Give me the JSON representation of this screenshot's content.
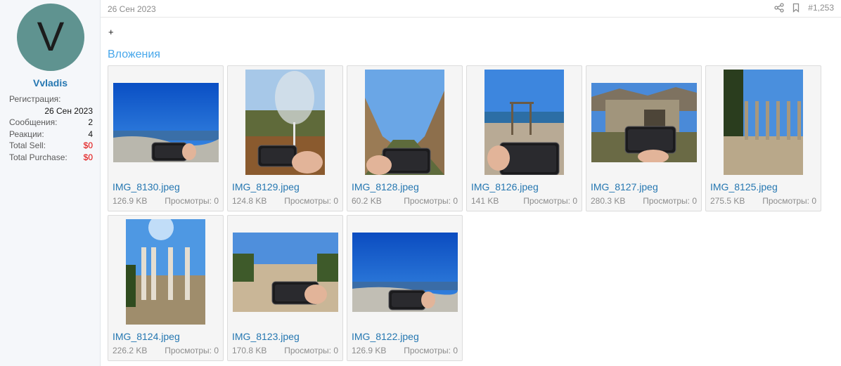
{
  "user": {
    "avatar_letter": "V",
    "avatar_color": "#5f9390",
    "name": "Vvladis",
    "registration_label": "Регистрация:",
    "registration_date": "26 Сен 2023",
    "stats": [
      {
        "label": "Сообщения:",
        "value": "2"
      },
      {
        "label": "Реакции:",
        "value": "4"
      },
      {
        "label": "Total Sell:",
        "value": "$0"
      },
      {
        "label": "Total Purchase:",
        "value": "$0"
      }
    ]
  },
  "post": {
    "date": "26 Сен 2023",
    "number": "#1,253",
    "body": "+",
    "attachments_title": "Вложения"
  },
  "attachments": [
    {
      "name": "IMG_8130.jpeg",
      "size": "126.9 KB",
      "views": "Просмотры: 0",
      "scene": "sea"
    },
    {
      "name": "IMG_8129.jpeg",
      "size": "124.8 KB",
      "views": "Просмотры: 0",
      "scene": "glass"
    },
    {
      "name": "IMG_8128.jpeg",
      "size": "60.2 KB",
      "views": "Просмотры: 0",
      "scene": "canyon"
    },
    {
      "name": "IMG_8126.jpeg",
      "size": "141 KB",
      "views": "Просмотры: 0",
      "scene": "beach"
    },
    {
      "name": "IMG_8127.jpeg",
      "size": "280.3 KB",
      "views": "Просмотры: 0",
      "scene": "ruins"
    },
    {
      "name": "IMG_8125.jpeg",
      "size": "275.5 KB",
      "views": "Просмотры: 0",
      "scene": "arches"
    },
    {
      "name": "IMG_8124.jpeg",
      "size": "226.2 KB",
      "views": "Просмотры: 0",
      "scene": "columns"
    },
    {
      "name": "IMG_8123.jpeg",
      "size": "170.8 KB",
      "views": "Просмотры: 0",
      "scene": "field"
    },
    {
      "name": "IMG_8122.jpeg",
      "size": "126.9 KB",
      "views": "Просмотры: 0",
      "scene": "sea2"
    }
  ],
  "icons": {
    "share": "share-icon",
    "bookmark": "bookmark-icon"
  },
  "colors": {
    "link": "#2577b1",
    "heading": "#47a7eb",
    "money": "#e00000"
  }
}
